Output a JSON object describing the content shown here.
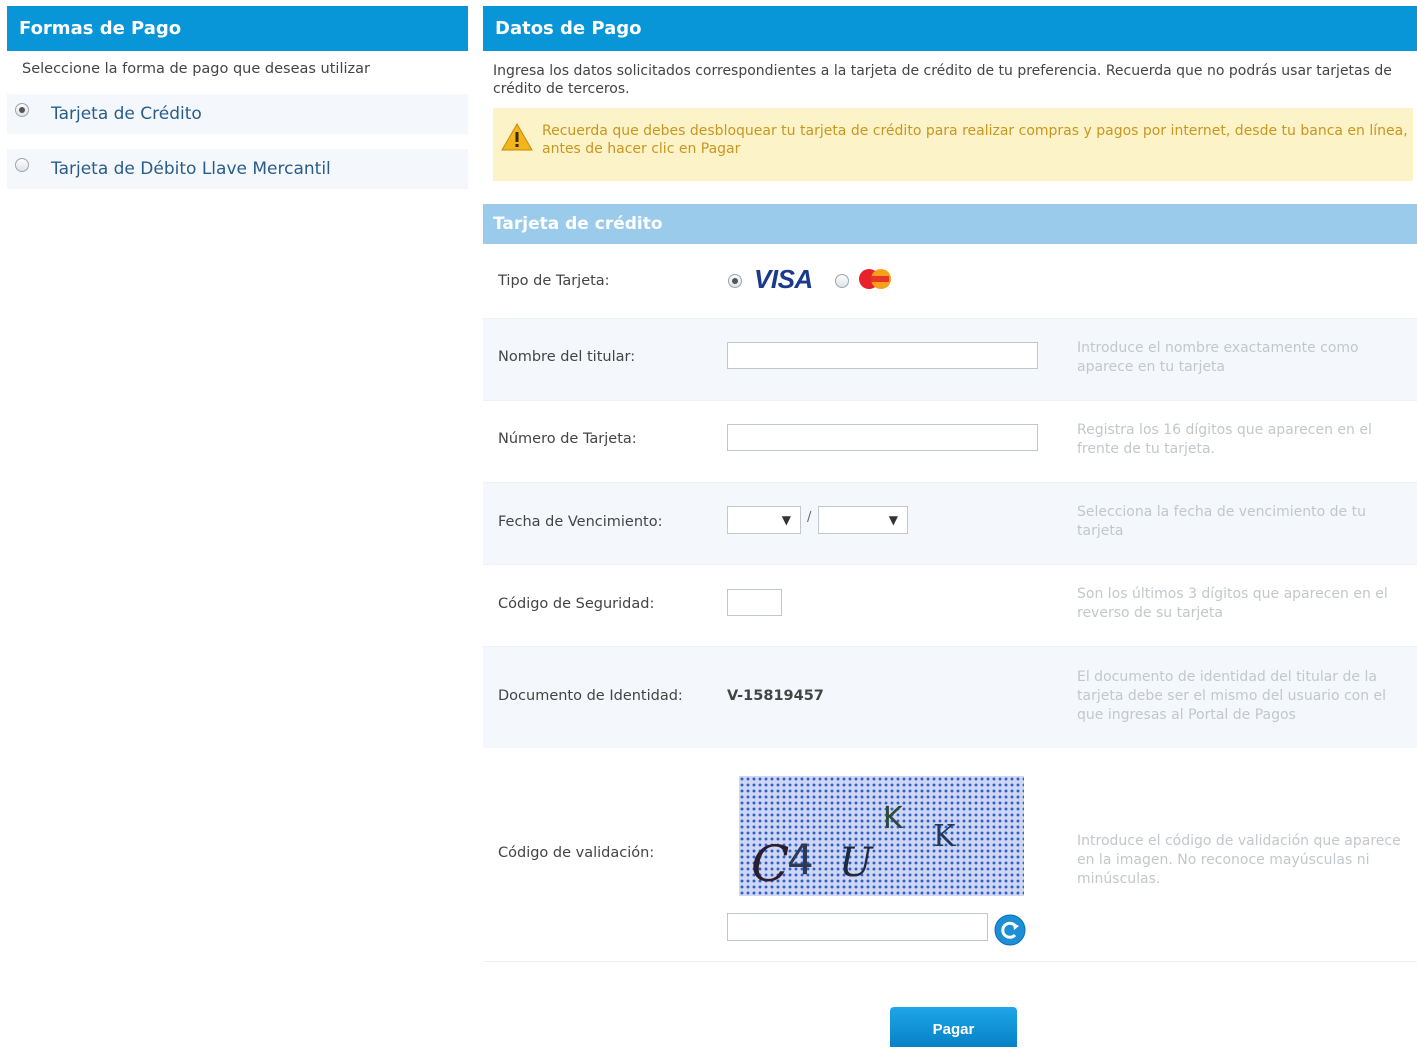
{
  "payment_methods": {
    "title": "Formas de Pago",
    "instruction": "Seleccione la forma de pago que deseas utilizar",
    "options": [
      {
        "label": "Tarjeta de Crédito",
        "selected": true
      },
      {
        "label": "Tarjeta de Débito Llave Mercantil",
        "selected": false
      }
    ]
  },
  "payment_data": {
    "title": "Datos de Pago",
    "intro": "Ingresa los datos solicitados correspondientes a la tarjeta de crédito de tu preferencia. Recuerda que no podrás usar tarjetas de crédito de terceros.",
    "warning": "Recuerda que debes desbloquear tu tarjeta de crédito para realizar compras y pagos por internet, desde tu banca en línea, antes de hacer clic en Pagar",
    "warning_color": "#c9961e",
    "section_title": "Tarjeta de crédito",
    "card_type": {
      "label": "Tipo de Tarjeta:",
      "options": [
        "VISA",
        "mastercard-logo"
      ],
      "selected": "VISA"
    },
    "holder": {
      "label": "Nombre del titular:",
      "value": "",
      "hint": "Introduce el nombre exactamente como aparece en tu tarjeta"
    },
    "card_number": {
      "label": "Número de Tarjeta:",
      "value": "",
      "hint": "Registra los 16 dígitos que aparecen en el frente de tu tarjeta."
    },
    "expiry": {
      "label": "Fecha de Vencimiento:",
      "month": "",
      "year": "",
      "separator": "/",
      "hint": "Selecciona la fecha de vencimiento de tu tarjeta"
    },
    "cvv": {
      "label": "Código de Seguridad:",
      "value": "",
      "hint": "Son los últimos 3 dígitos que aparecen en el reverso de su tarjeta"
    },
    "id_doc": {
      "label": "Documento de Identidad:",
      "value": "V-15819457",
      "hint": "El documento de identidad del titular de la tarjeta debe ser el mismo del usuario con el que ingresas al Portal de Pagos"
    },
    "captcha": {
      "label": "Código de validación:",
      "image_text": "C4UKK",
      "value": "",
      "hint": "Introduce el código de validación que aparece en la imagen. No reconoce mayúsculas ni minúsculas.",
      "refresh_icon": "refresh-icon"
    },
    "submit_label": "Pagar"
  },
  "colors": {
    "header": "#0996d9",
    "subheader": "#9acbea",
    "link": "#2a5c8a",
    "warning_bg": "#fdf3c8"
  }
}
